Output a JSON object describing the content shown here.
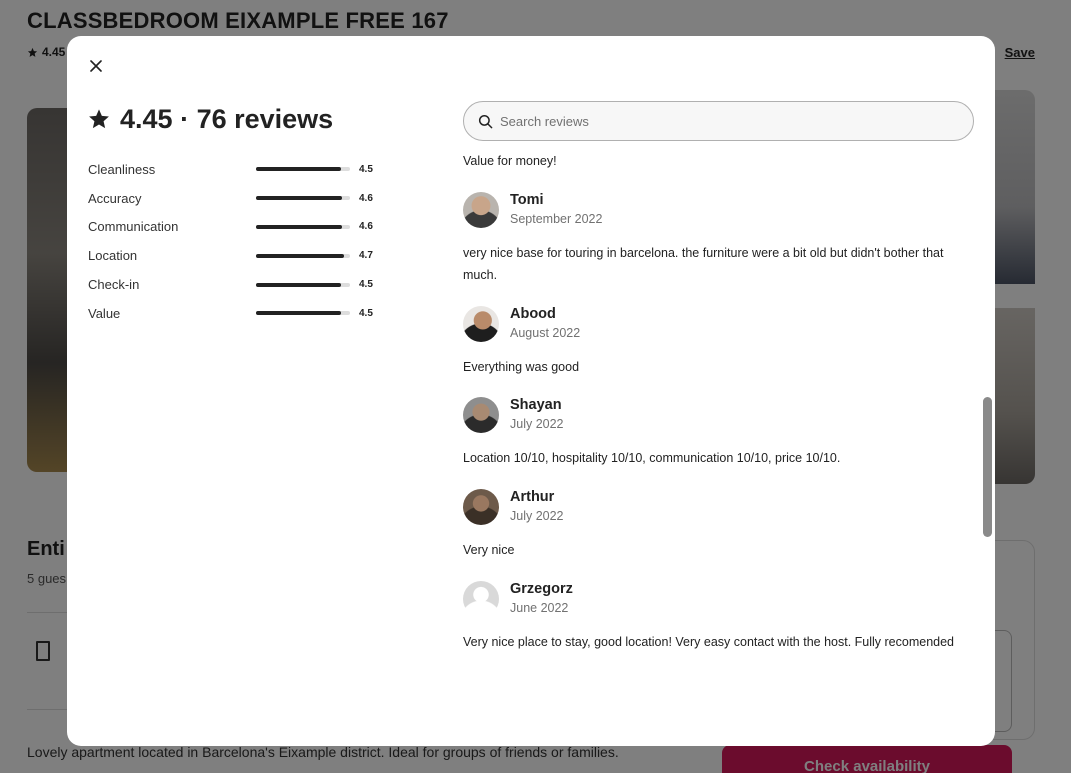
{
  "background": {
    "listing_title": "CLASSBEDROOM EIXAMPLE FREE 167",
    "rating_short": "4.45",
    "save_label": "Save",
    "entire_heading": "Enti",
    "guests_text": "5 gues",
    "description": "Lovely apartment located in Barcelona's Eixample district. Ideal for groups of friends or families.",
    "check_availability": "Check availability",
    "brand_color": "#d7185a"
  },
  "modal": {
    "close_icon": "close-icon",
    "summary": {
      "rating": "4.45",
      "separator": "·",
      "reviews_count": "76 reviews",
      "star_icon": "star-icon"
    },
    "categories": [
      {
        "label": "Cleanliness",
        "value": "4.5",
        "score": 4.5
      },
      {
        "label": "Accuracy",
        "value": "4.6",
        "score": 4.6
      },
      {
        "label": "Communication",
        "value": "4.6",
        "score": 4.6
      },
      {
        "label": "Location",
        "value": "4.7",
        "score": 4.7
      },
      {
        "label": "Check-in",
        "value": "4.5",
        "score": 4.5
      },
      {
        "label": "Value",
        "value": "4.5",
        "score": 4.5
      }
    ],
    "search": {
      "placeholder": "Search reviews",
      "icon": "search-icon"
    },
    "previous_review_tail": "Value for money!",
    "reviews": [
      {
        "name": "Tomi",
        "date": "September 2022",
        "text": "very nice base for touring in barcelona. the furniture were a bit old but didn't bother that much."
      },
      {
        "name": "Abood",
        "date": "August 2022",
        "text": "Everything was good"
      },
      {
        "name": "Shayan",
        "date": "July 2022",
        "text": "Location 10/10, hospitality 10/10, communication 10/10, price 10/10."
      },
      {
        "name": "Arthur",
        "date": "July 2022",
        "text": "Very nice"
      },
      {
        "name": "Grzegorz",
        "date": "June 2022",
        "text": "Very nice place to stay, good location! Very easy contact with the host. Fully recomended"
      }
    ]
  }
}
